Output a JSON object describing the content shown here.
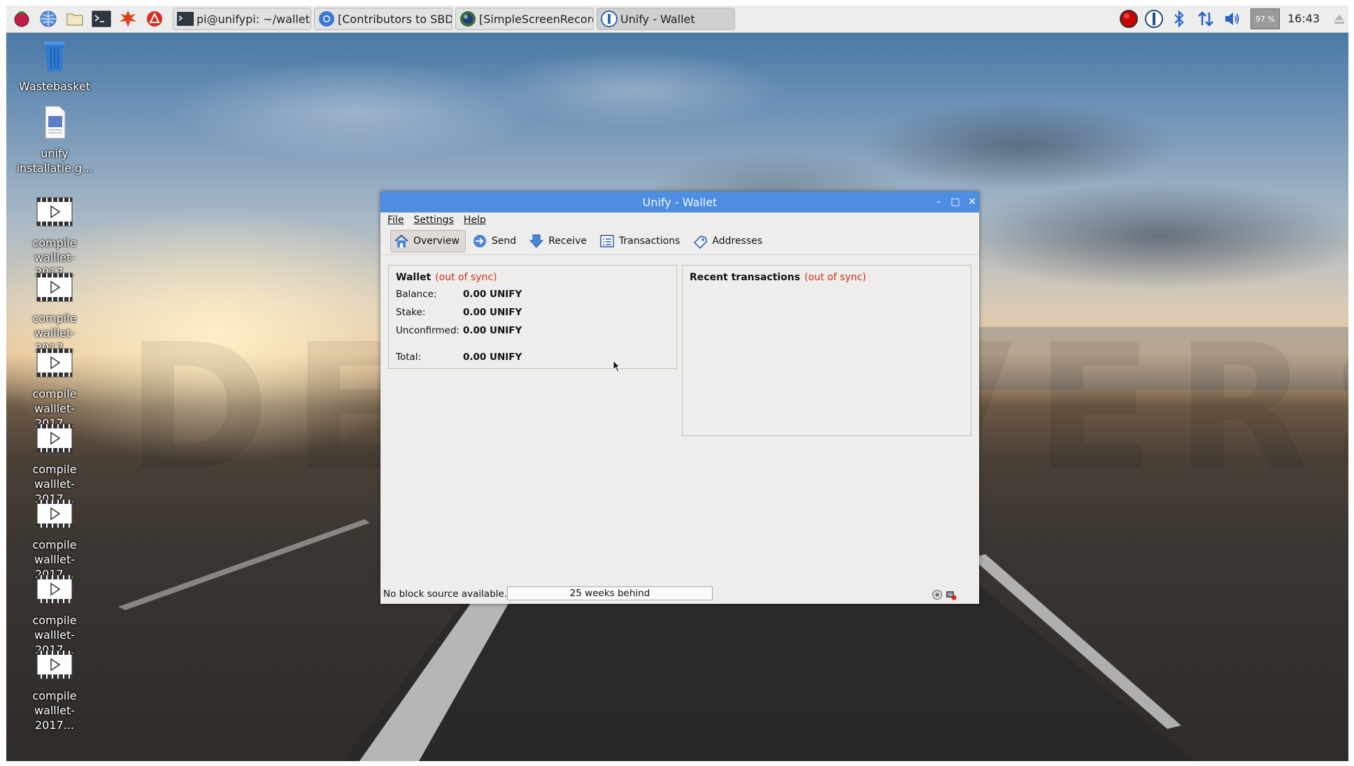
{
  "taskbar": {
    "launchers": [
      "raspberry-menu-icon",
      "web-browser-icon",
      "file-manager-icon",
      "terminal-icon",
      "math-icon",
      "wolfram-icon"
    ],
    "tasks": [
      {
        "label": "pi@unifypi: ~/wallet",
        "icon": "terminal-icon"
      },
      {
        "label": "[Contributors to SBDo...",
        "icon": "chromium-icon"
      },
      {
        "label": "[SimpleScreenRecord...",
        "icon": "screen-recorder-icon"
      },
      {
        "label": "Unify - Wallet",
        "icon": "unify-icon"
      }
    ],
    "tray": {
      "icons": [
        "record-icon",
        "unify-tray-icon",
        "bluetooth-icon",
        "network-icon",
        "volume-icon"
      ],
      "cpu": "97 %",
      "clock": "16:43",
      "eject_icon": "eject-icon"
    }
  },
  "desktop": {
    "icons": [
      {
        "label": "Wastebasket",
        "icon": "trash-icon"
      },
      {
        "label": "unify installatie.g...",
        "icon": "document-icon"
      },
      {
        "label": "compile walllet-2017...",
        "icon": "video-icon"
      },
      {
        "label": "compile walllet-2017...",
        "icon": "video-icon"
      },
      {
        "label": "compile walllet-2017...",
        "icon": "video-icon"
      },
      {
        "label": "compile walllet-2017...",
        "icon": "video-icon"
      },
      {
        "label": "compile walllet-2017...",
        "icon": "video-icon"
      },
      {
        "label": "compile walllet-2017...",
        "icon": "video-icon"
      },
      {
        "label": "compile walllet-2017...",
        "icon": "video-icon"
      }
    ],
    "watermark": "DEMO VERSION"
  },
  "window": {
    "title": "Unify - Wallet",
    "menu": [
      "File",
      "Settings",
      "Help"
    ],
    "toolbar": [
      {
        "label": "Overview",
        "icon": "home-icon",
        "active": true
      },
      {
        "label": "Send",
        "icon": "send-icon",
        "active": false
      },
      {
        "label": "Receive",
        "icon": "receive-icon",
        "active": false
      },
      {
        "label": "Transactions",
        "icon": "transactions-icon",
        "active": false
      },
      {
        "label": "Addresses",
        "icon": "addresses-icon",
        "active": false
      }
    ],
    "wallet": {
      "title": "Wallet",
      "sync": "(out of sync)",
      "balance_label": "Balance:",
      "balance": "0.00 UNIFY",
      "stake_label": "Stake:",
      "stake": "0.00 UNIFY",
      "unconfirmed_label": "Unconfirmed:",
      "unconfirmed": "0.00 UNIFY",
      "total_label": "Total:",
      "total": "0.00 UNIFY"
    },
    "recent": {
      "title": "Recent transactions",
      "sync": "(out of sync)"
    },
    "status": {
      "text": "No block source available...",
      "progress": "25 weeks behind"
    }
  }
}
